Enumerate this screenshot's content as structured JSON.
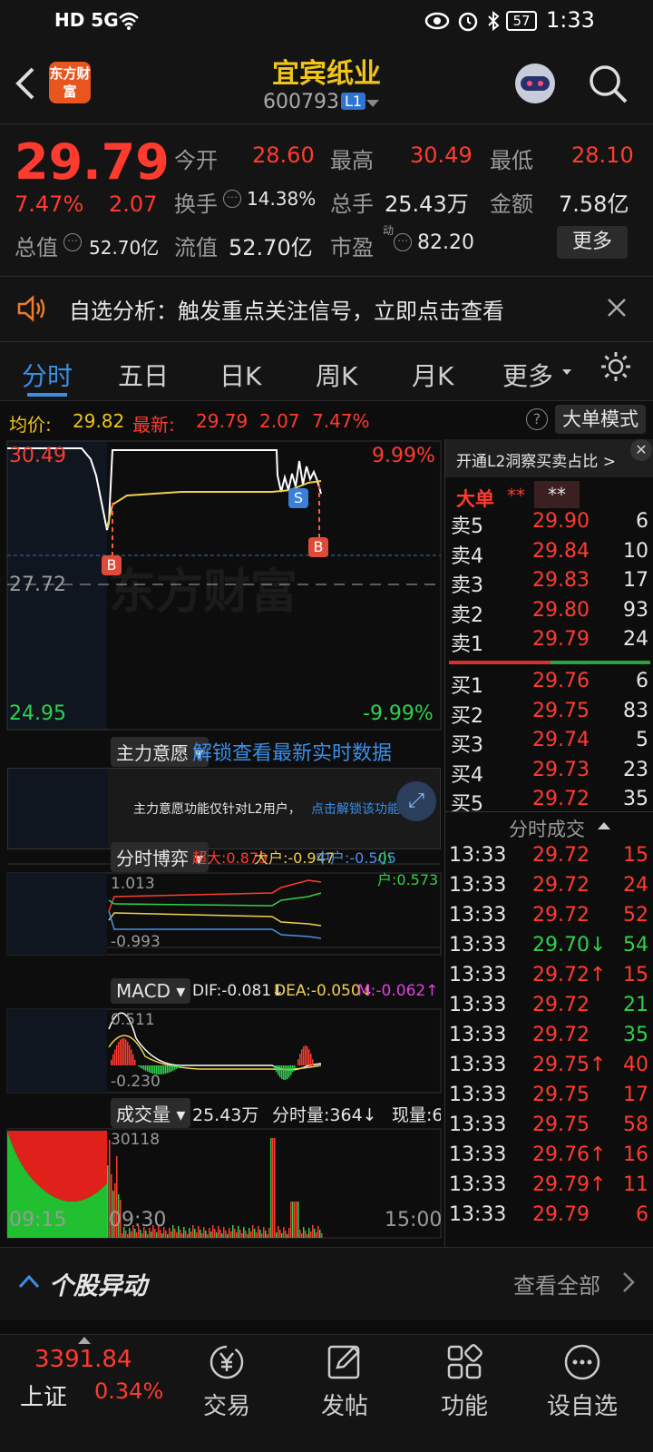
{
  "status_bar": {
    "left_icons": "HD 5G",
    "battery": "57",
    "time": "1:33"
  },
  "header": {
    "logo_text": "东方财富",
    "title": "宜宾纸业",
    "code": "600793",
    "level_badge": "L1"
  },
  "quote": {
    "price": "29.79",
    "change_pct": "7.47%",
    "change": "2.07",
    "open_label": "今开",
    "open": "28.60",
    "high_label": "最高",
    "high": "30.49",
    "low_label": "最低",
    "low": "28.10",
    "turnover_label": "换手",
    "turnover": "14.38%",
    "volume_label": "总手",
    "volume": "25.43万",
    "amount_label": "金额",
    "amount": "7.58亿",
    "mcap_label": "总值",
    "mcap": "52.70亿",
    "float_label": "流值",
    "float": "52.70亿",
    "pe_label": "市盈",
    "pe_sup": "动",
    "pe": "82.20",
    "more_btn": "更多"
  },
  "notice": {
    "text": "自选分析：触发重点关注信号，立即点击查看"
  },
  "tabs": [
    "分时",
    "五日",
    "日K",
    "周K",
    "月K",
    "更多"
  ],
  "avg_bar": {
    "avg_label": "均价:",
    "avg": "29.82",
    "latest_label": "最新:",
    "latest": "29.79",
    "chg": "2.07",
    "pct": "7.47%",
    "mode_btn": "大单模式"
  },
  "chart": {
    "price_high": "30.49",
    "price_mid": "27.72",
    "price_low": "24.95",
    "pct_high": "9.99%",
    "pct_low": "-9.99%",
    "marker_b": "B",
    "marker_s": "S",
    "watermark": "东方财富",
    "main_intent_label": "主力意愿",
    "unlock_text": "解锁查看最新实时数据",
    "l2_notice": "主力意愿功能仅针对L2用户，",
    "l2_link": "点击解锁该功能",
    "game_label": "分时博弈",
    "game_vals": {
      "super": "超大:0.879",
      "large": "大户:-0.947",
      "mid": "中户:-0.505",
      "small": "小户:0.573"
    },
    "game_top": "1.013",
    "game_bottom": "-0.993",
    "macd_label": "MACD",
    "dif": "DIF:-0.081↓",
    "dea": "DEA:-0.050↓",
    "m": "M:-0.062↑",
    "macd_top": "0.511",
    "macd_bottom": "-0.230",
    "vol_label": "成交量",
    "vol_total": "25.43万",
    "vol_min": "分时量:364↓",
    "vol_now": "现量:6",
    "vol_max": "30118",
    "time_start": "09:15",
    "time_open": "09:30",
    "time_end": "15:00"
  },
  "book": {
    "l2_promo": "开通L2洞察买卖占比 >",
    "big_label": "大单",
    "big_a": "**",
    "big_b": "**",
    "asks": [
      {
        "label": "卖5",
        "price": "29.90",
        "vol": "6"
      },
      {
        "label": "卖4",
        "price": "29.84",
        "vol": "10"
      },
      {
        "label": "卖3",
        "price": "29.83",
        "vol": "17"
      },
      {
        "label": "卖2",
        "price": "29.80",
        "vol": "93"
      },
      {
        "label": "卖1",
        "price": "29.79",
        "vol": "24"
      }
    ],
    "bids": [
      {
        "label": "买1",
        "price": "29.76",
        "vol": "6"
      },
      {
        "label": "买2",
        "price": "29.75",
        "vol": "83"
      },
      {
        "label": "买3",
        "price": "29.74",
        "vol": "5"
      },
      {
        "label": "买4",
        "price": "29.73",
        "vol": "23"
      },
      {
        "label": "买5",
        "price": "29.72",
        "vol": "35"
      }
    ],
    "ticks_title": "分时成交",
    "ticks": [
      {
        "t": "13:33",
        "p": "29.72",
        "v": "15",
        "c": "red"
      },
      {
        "t": "13:33",
        "p": "29.72",
        "v": "24",
        "c": "red"
      },
      {
        "t": "13:33",
        "p": "29.72",
        "v": "52",
        "c": "red"
      },
      {
        "t": "13:33",
        "p": "29.70↓",
        "v": "54",
        "c": "grn"
      },
      {
        "t": "13:33",
        "p": "29.72↑",
        "v": "15",
        "c": "red"
      },
      {
        "t": "13:33",
        "p": "29.72",
        "v": "21",
        "c": "grn"
      },
      {
        "t": "13:33",
        "p": "29.72",
        "v": "35",
        "c": "grn"
      },
      {
        "t": "13:33",
        "p": "29.75↑",
        "v": "40",
        "c": "red"
      },
      {
        "t": "13:33",
        "p": "29.75",
        "v": "17",
        "c": "red"
      },
      {
        "t": "13:33",
        "p": "29.75",
        "v": "58",
        "c": "red"
      },
      {
        "t": "13:33",
        "p": "29.76↑",
        "v": "16",
        "c": "red"
      },
      {
        "t": "13:33",
        "p": "29.79↑",
        "v": "11",
        "c": "red"
      },
      {
        "t": "13:33",
        "p": "29.79",
        "v": "6",
        "c": "red"
      }
    ]
  },
  "bottom": {
    "title": "个股异动",
    "view_all": "查看全部"
  },
  "nav": {
    "index_value": "3391.84",
    "index_name": "上证",
    "index_pct": "0.34%",
    "trade": "交易",
    "post": "发帖",
    "func": "功能",
    "watch": "设自选"
  }
}
